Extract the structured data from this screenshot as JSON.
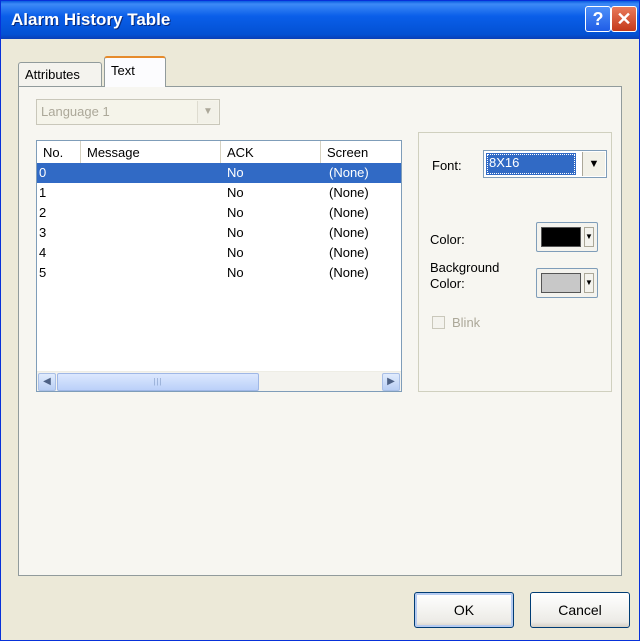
{
  "window": {
    "title": "Alarm History Table",
    "help_label": "?",
    "close_label": "✕"
  },
  "tabs": [
    {
      "label": "Attributes"
    },
    {
      "label": "Text"
    }
  ],
  "language": {
    "value": "Language 1"
  },
  "table": {
    "columns": [
      "No.",
      "Message",
      "ACK",
      "Screen"
    ],
    "rows": [
      {
        "no": "0",
        "message": "",
        "ack": "No",
        "screen": "(None)"
      },
      {
        "no": "1",
        "message": "",
        "ack": "No",
        "screen": "(None)"
      },
      {
        "no": "2",
        "message": "",
        "ack": "No",
        "screen": "(None)"
      },
      {
        "no": "3",
        "message": "",
        "ack": "No",
        "screen": "(None)"
      },
      {
        "no": "4",
        "message": "",
        "ack": "No",
        "screen": "(None)"
      },
      {
        "no": "5",
        "message": "",
        "ack": "No",
        "screen": "(None)"
      }
    ],
    "selected_row": 0
  },
  "properties": {
    "font_label": "Font:",
    "font_value": "8X16",
    "color_label": "Color:",
    "color_value": "#000000",
    "bg_color_label": "Background Color:",
    "bg_color_label_line1": "Background",
    "bg_color_label_line2": "Color:",
    "bg_color_value": "#c8c8c8",
    "blink_label": "Blink",
    "blink_checked": false
  },
  "buttons": {
    "ok": "OK",
    "cancel": "Cancel"
  }
}
